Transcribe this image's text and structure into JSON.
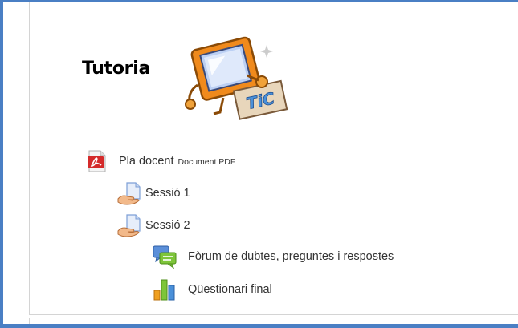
{
  "section": {
    "title": "Tutoria",
    "logo_text": "TiC"
  },
  "activities": [
    {
      "label": "Pla docent",
      "type": "Document PDF",
      "icon": "pdf-icon"
    },
    {
      "label": "Sessió 1",
      "icon": "page-resource-icon"
    },
    {
      "label": "Sessió 2",
      "icon": "page-resource-icon"
    },
    {
      "label": "Fòrum de dubtes, preguntes i respostes",
      "icon": "forum-icon"
    },
    {
      "label": "Qüestionari final",
      "icon": "quiz-icon"
    }
  ],
  "colors": {
    "frame_border": "#4a7fc4",
    "panel_border": "#d4d4d4",
    "text": "#333333"
  }
}
